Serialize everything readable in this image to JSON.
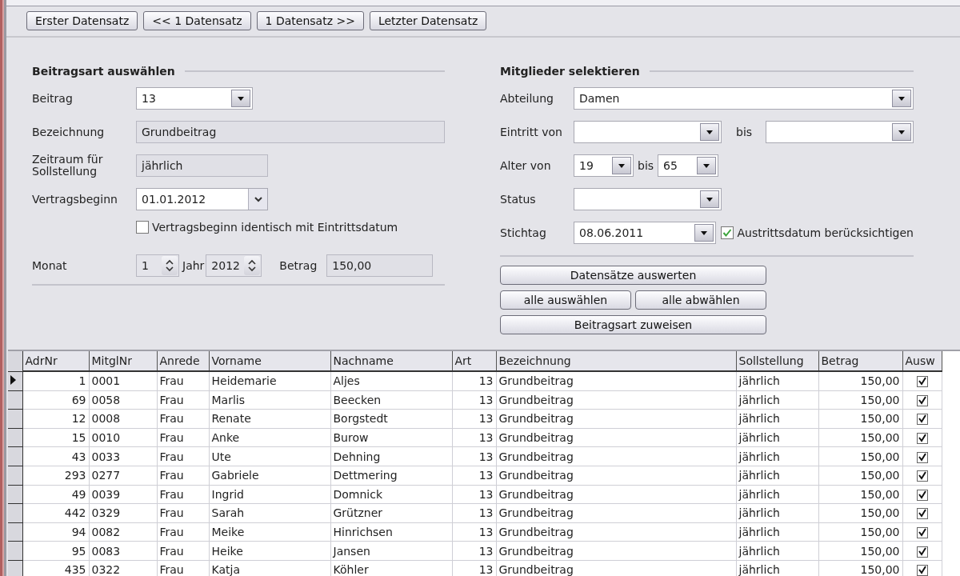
{
  "nav_buttons": [
    "Erster Datensatz",
    "<< 1 Datensatz",
    "1 Datensatz >>",
    "Letzter Datensatz"
  ],
  "beitragsart": {
    "heading": "Beitragsart auswählen",
    "beitrag": {
      "label": "Beitrag",
      "value": "13"
    },
    "bezeichnung": {
      "label": "Bezeichnung",
      "value": "Grundbeitrag"
    },
    "zeitraum": {
      "label": "Zeitraum für Sollstellung",
      "value": "jährlich"
    },
    "vertragsbeginn": {
      "label": "Vertragsbeginn",
      "value": "01.01.2012"
    },
    "identisch": {
      "label": "Vertragsbeginn identisch mit Eintrittsdatum",
      "checked": false
    },
    "monat": {
      "label": "Monat",
      "value": "1"
    },
    "jahr": {
      "label": "Jahr",
      "value": "2012"
    },
    "betrag": {
      "label": "Betrag",
      "value": "150,00"
    }
  },
  "mitglieder": {
    "heading": "Mitglieder selektieren",
    "abteilung": {
      "label": "Abteilung",
      "value": "Damen"
    },
    "eintritt": {
      "label": "Eintritt von",
      "to_label": "bis"
    },
    "alter": {
      "label": "Alter von",
      "from": "19",
      "to_label": "bis",
      "to": "65"
    },
    "status": {
      "label": "Status"
    },
    "stichtag": {
      "label": "Stichtag",
      "value": "08.06.2011"
    },
    "austritt": {
      "label": "Austrittsdatum berücksichtigen",
      "checked": true
    },
    "buttons": [
      "Datensätze auswerten",
      "alle auswählen",
      "alle abwählen",
      "Beitragsart zuweisen"
    ]
  },
  "table": {
    "columns": [
      "AdrNr",
      "MitglNr",
      "Anrede",
      "Vorname",
      "Nachname",
      "Art",
      "Bezeichnung",
      "Sollstellung",
      "Betrag",
      "Ausw"
    ],
    "rows": [
      {
        "current": true,
        "checked": true,
        "cells": [
          "1",
          "0001",
          "Frau",
          "Heidemarie",
          "Aljes",
          "13",
          "Grundbeitrag",
          "jährlich",
          "150,00"
        ]
      },
      {
        "current": false,
        "checked": true,
        "cells": [
          "69",
          "0058",
          "Frau",
          "Marlis",
          "Beecken",
          "13",
          "Grundbeitrag",
          "jährlich",
          "150,00"
        ]
      },
      {
        "current": false,
        "checked": true,
        "cells": [
          "12",
          "0008",
          "Frau",
          "Renate",
          "Borgstedt",
          "13",
          "Grundbeitrag",
          "jährlich",
          "150,00"
        ]
      },
      {
        "current": false,
        "checked": true,
        "cells": [
          "15",
          "0010",
          "Frau",
          "Anke",
          "Burow",
          "13",
          "Grundbeitrag",
          "jährlich",
          "150,00"
        ]
      },
      {
        "current": false,
        "checked": true,
        "cells": [
          "43",
          "0033",
          "Frau",
          "Ute",
          "Dehning",
          "13",
          "Grundbeitrag",
          "jährlich",
          "150,00"
        ]
      },
      {
        "current": false,
        "checked": true,
        "cells": [
          "293",
          "0277",
          "Frau",
          "Gabriele",
          "Dettmering",
          "13",
          "Grundbeitrag",
          "jährlich",
          "150,00"
        ]
      },
      {
        "current": false,
        "checked": true,
        "cells": [
          "49",
          "0039",
          "Frau",
          "Ingrid",
          "Domnick",
          "13",
          "Grundbeitrag",
          "jährlich",
          "150,00"
        ]
      },
      {
        "current": false,
        "checked": true,
        "cells": [
          "442",
          "0329",
          "Frau",
          "Sarah",
          "Grützner",
          "13",
          "Grundbeitrag",
          "jährlich",
          "150,00"
        ]
      },
      {
        "current": false,
        "checked": true,
        "cells": [
          "94",
          "0082",
          "Frau",
          "Meike",
          "Hinrichsen",
          "13",
          "Grundbeitrag",
          "jährlich",
          "150,00"
        ]
      },
      {
        "current": false,
        "checked": true,
        "cells": [
          "95",
          "0083",
          "Frau",
          "Heike",
          "Jansen",
          "13",
          "Grundbeitrag",
          "jährlich",
          "150,00"
        ]
      },
      {
        "current": false,
        "checked": true,
        "cells": [
          "435",
          "0322",
          "Frau",
          "Katja",
          "Köhler",
          "13",
          "Grundbeitrag",
          "jährlich",
          "150,00"
        ]
      }
    ]
  }
}
